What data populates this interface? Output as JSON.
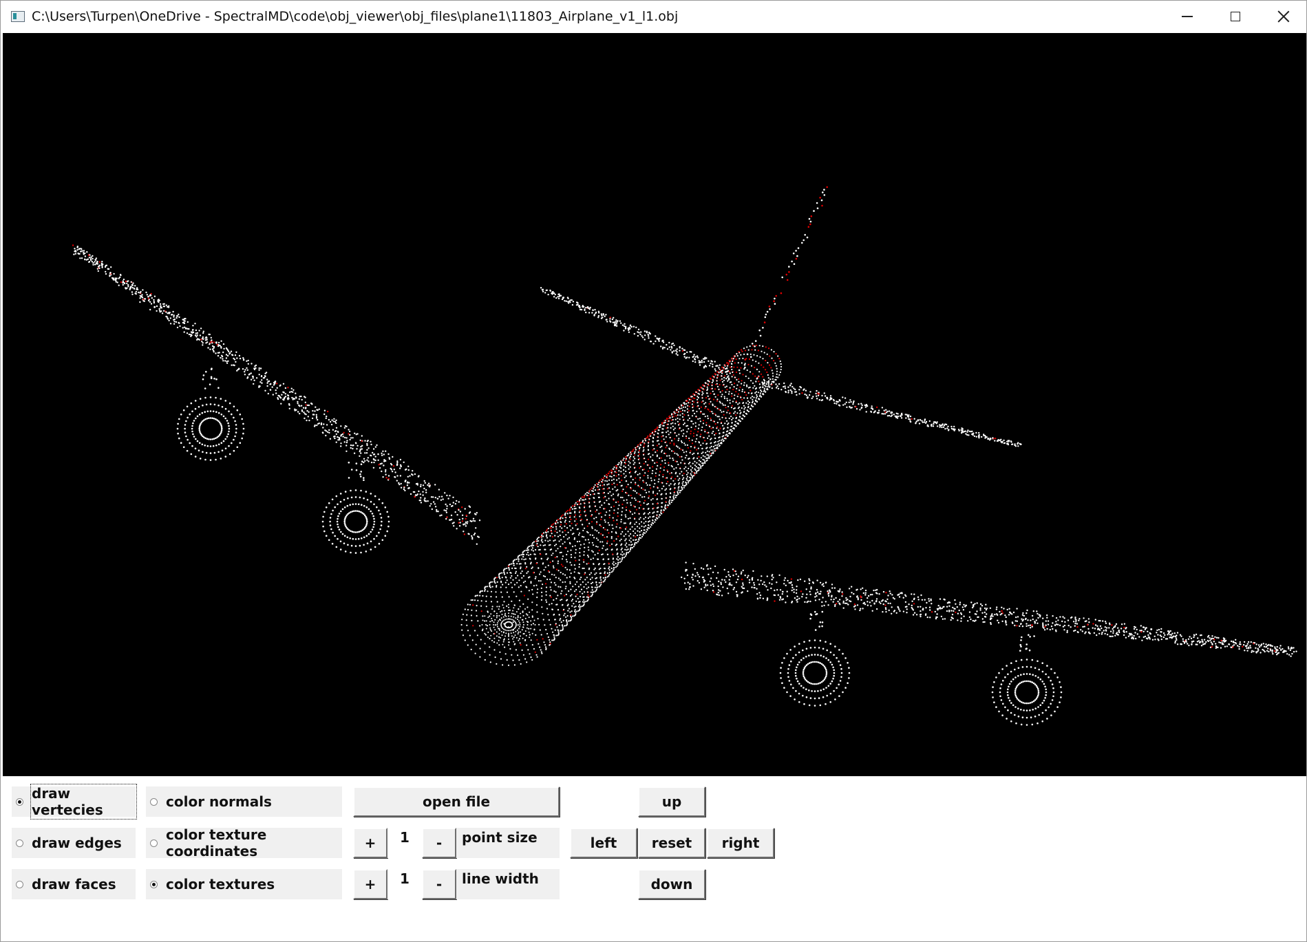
{
  "window": {
    "title": "C:\\Users\\Turpen\\OneDrive - SpectralMD\\code\\obj_viewer\\obj_files\\plane1\\11803_Airplane_v1_l1.obj"
  },
  "viewport": {
    "background": "#000000",
    "point_color": "#ffffff",
    "texture_color": "#e00000"
  },
  "controls": {
    "draw_mode": {
      "options": [
        "draw vertecies",
        "draw edges",
        "draw faces"
      ],
      "selected": "draw vertecies"
    },
    "color_mode": {
      "options": [
        "color normals",
        "color texture coordinates",
        "color textures"
      ],
      "selected": "color textures"
    },
    "open_file_label": "open file",
    "point_size": {
      "plus": "+",
      "value": "1",
      "minus": "-",
      "label": "point size"
    },
    "line_width": {
      "plus": "+",
      "value": "1",
      "minus": "-",
      "label": "line width"
    },
    "nav": {
      "up": "up",
      "left": "left",
      "reset": "reset",
      "right": "right",
      "down": "down"
    }
  }
}
